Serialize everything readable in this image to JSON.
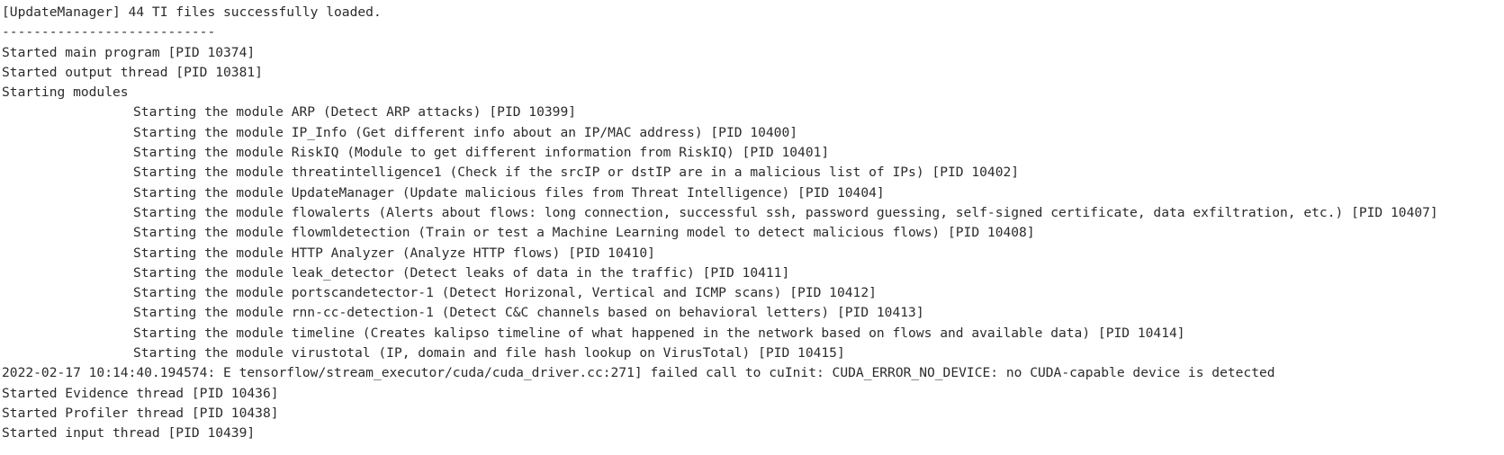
{
  "terminal": {
    "lines": [
      {
        "text": "[UpdateManager] 44 TI files successfully loaded.",
        "indent": false
      },
      {
        "text": "---------------------------",
        "indent": false
      },
      {
        "text": "Started main program [PID 10374]",
        "indent": false
      },
      {
        "text": "Started output thread [PID 10381]",
        "indent": false
      },
      {
        "text": "Starting modules",
        "indent": false
      },
      {
        "text": "Starting the module ARP (Detect ARP attacks) [PID 10399]",
        "indent": true
      },
      {
        "text": "Starting the module IP_Info (Get different info about an IP/MAC address) [PID 10400]",
        "indent": true
      },
      {
        "text": "Starting the module RiskIQ (Module to get different information from RiskIQ) [PID 10401]",
        "indent": true
      },
      {
        "text": "Starting the module threatintelligence1 (Check if the srcIP or dstIP are in a malicious list of IPs) [PID 10402]",
        "indent": true
      },
      {
        "text": "Starting the module UpdateManager (Update malicious files from Threat Intelligence) [PID 10404]",
        "indent": true
      },
      {
        "text": "Starting the module flowalerts (Alerts about flows: long connection, successful ssh, password guessing, self-signed certificate, data exfiltration, etc.) [PID 10407]",
        "indent": true
      },
      {
        "text": "Starting the module flowmldetection (Train or test a Machine Learning model to detect malicious flows) [PID 10408]",
        "indent": true
      },
      {
        "text": "Starting the module HTTP Analyzer (Analyze HTTP flows) [PID 10410]",
        "indent": true
      },
      {
        "text": "Starting the module leak_detector (Detect leaks of data in the traffic) [PID 10411]",
        "indent": true
      },
      {
        "text": "Starting the module portscandetector-1 (Detect Horizonal, Vertical and ICMP scans) [PID 10412]",
        "indent": true
      },
      {
        "text": "Starting the module rnn-cc-detection-1 (Detect C&C channels based on behavioral letters) [PID 10413]",
        "indent": true
      },
      {
        "text": "Starting the module timeline (Creates kalipso timeline of what happened in the network based on flows and available data) [PID 10414]",
        "indent": true
      },
      {
        "text": "Starting the module virustotal (IP, domain and file hash lookup on VirusTotal) [PID 10415]",
        "indent": true
      },
      {
        "text": "2022-02-17 10:14:40.194574: E tensorflow/stream_executor/cuda/cuda_driver.cc:271] failed call to cuInit: CUDA_ERROR_NO_DEVICE: no CUDA-capable device is detected",
        "indent": false
      },
      {
        "text": "Started Evidence thread [PID 10436]",
        "indent": false
      },
      {
        "text": "Started Profiler thread [PID 10438]",
        "indent": false
      },
      {
        "text": "Started input thread [PID 10439]",
        "indent": false
      }
    ]
  },
  "colors": {
    "background": "#ffffff",
    "text": "#2b2b2b"
  }
}
